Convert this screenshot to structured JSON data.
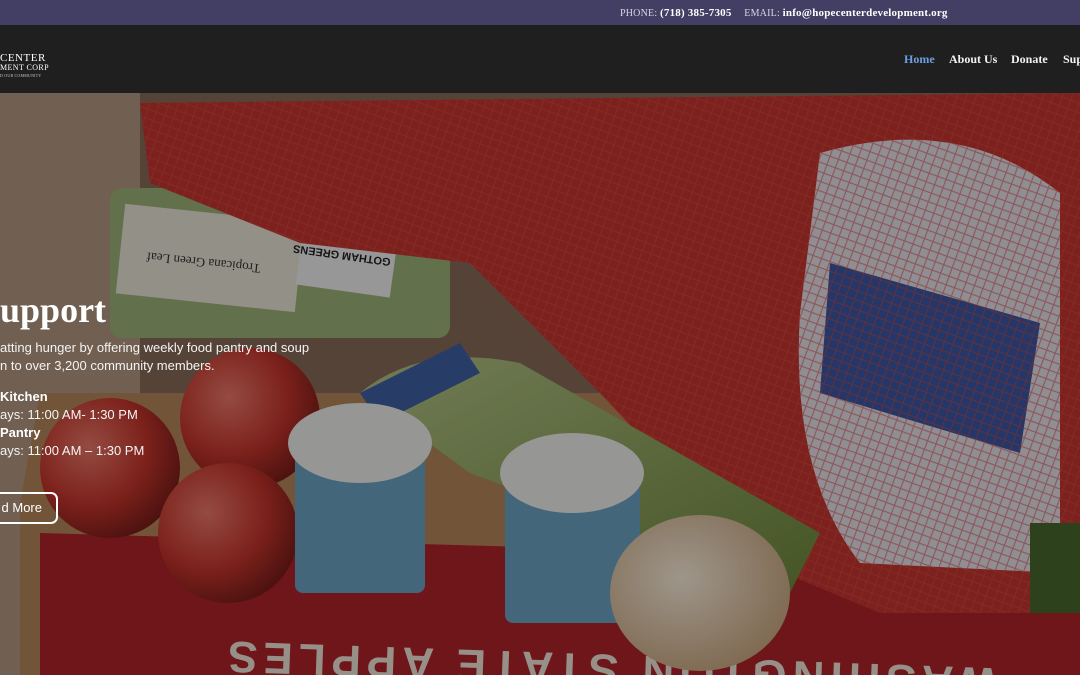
{
  "topbar": {
    "phone_label": "PHONE:",
    "phone_value": "(718) 385-7305",
    "email_label": "EMAIL:",
    "email_value": "info@hopecenterdevelopment.org"
  },
  "logo": {
    "line1": "CENTER",
    "line2": "MENT CORP",
    "line3": "D OUR COMMUNITY"
  },
  "nav": {
    "items": [
      "Home",
      "About Us",
      "Donate",
      "Sup"
    ],
    "active": "Home"
  },
  "hero": {
    "title": "upport",
    "desc_line1": "atting hunger by offering weekly food pantry and soup",
    "desc_line2": "n to over 3,200 community members.",
    "kitchen_label": "Kitchen",
    "kitchen_hours": "ays: 11:00 AM- 1:30 PM",
    "pantry_label": "Pantry",
    "pantry_hours": "ays: 11:00 AM – 1:30 PM",
    "button_label": "d More",
    "box_text": "WASHINGTON STATE APPLES",
    "package_text_1": "GOTHAM GREENS",
    "package_text_2": "Tropicana Green Leaf"
  },
  "colors": {
    "topbar_bg": "#433e63",
    "header_bg": "#1f1f1f",
    "nav_active": "#6c9fe0",
    "box_red": "#b3242a",
    "mesh_red": "#c8362f"
  }
}
